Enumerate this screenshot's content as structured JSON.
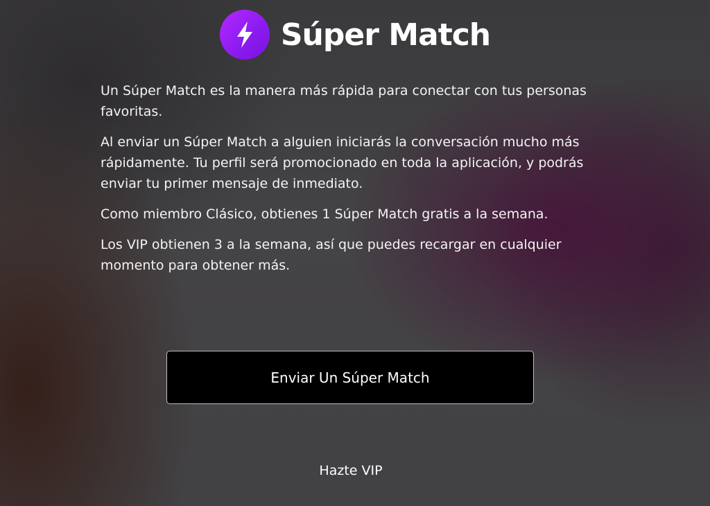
{
  "header": {
    "logo_icon": "lightning-bolt-icon",
    "title": "Súper Match"
  },
  "description": {
    "paragraphs": [
      "Un Súper Match es la manera más rápida para conectar con tus personas favoritas.",
      "Al enviar un Súper Match a alguien iniciarás la conversación mucho más rápidamente. Tu perfil será promocionado en toda la aplicación, y podrás enviar tu primer mensaje de inmediato.",
      "Como miembro Clásico, obtienes 1 Súper Match gratis a la semana.",
      "Los VIP obtienen 3 a la semana, así que puedes recargar en cualquier momento para obtener más."
    ]
  },
  "actions": {
    "primary_label": "Enviar Un Súper Match",
    "secondary_label": "Hazte VIP"
  },
  "colors": {
    "accent": "#9b21f5",
    "button_bg": "#000000",
    "text": "#ffffff"
  }
}
